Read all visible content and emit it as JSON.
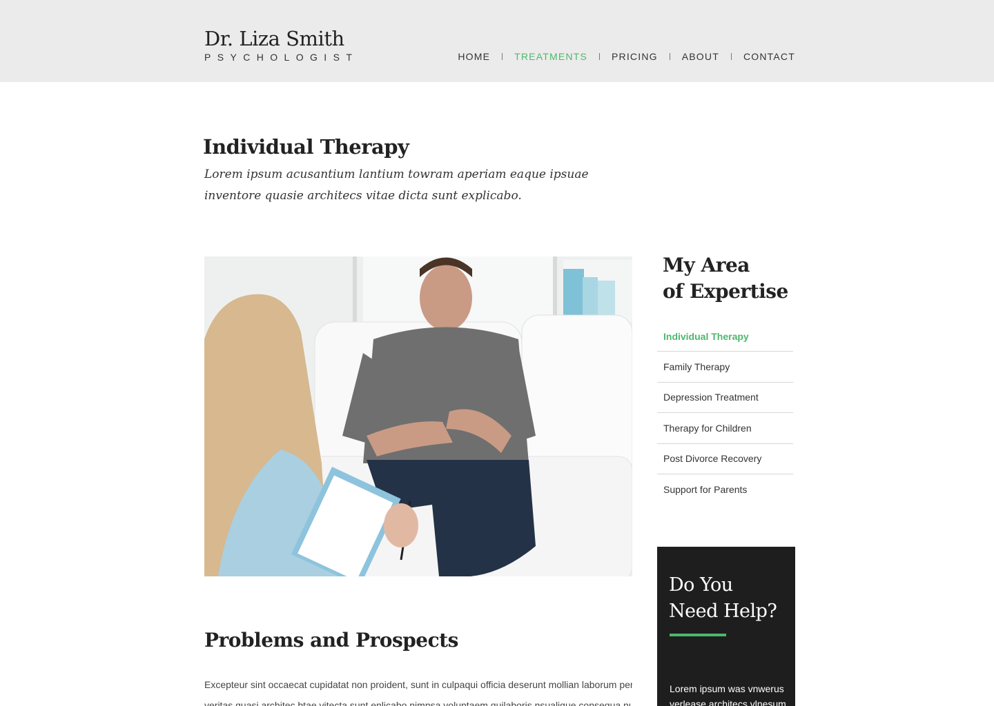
{
  "header": {
    "logo_name": "Dr. Liza Smith",
    "logo_sub": "PSYCHOLOGIST",
    "nav": [
      {
        "label": "HOME",
        "active": false
      },
      {
        "label": "TREATMENTS",
        "active": true
      },
      {
        "label": "PRICING",
        "active": false
      },
      {
        "label": "ABOUT",
        "active": false
      },
      {
        "label": "CONTACT",
        "active": false
      }
    ]
  },
  "main": {
    "title": "Individual Therapy",
    "intro": "Lorem ipsum acusantium lantium towram aperiam eaque ipsuae inventore quasie architecs vitae dicta sunt explicabo.",
    "section_title": "Problems and Prospects",
    "section_lines": [
      "Excepteur sint occaecat cupidatat non proident, sunt in culpaqui officia deserunt mollian laborum perscas",
      "veritas quasi architec btae vitecta sunt enlicabo nimpsa voluptaem quilaboris nsualique consequa nuisaute"
    ]
  },
  "sidebar": {
    "expertise_title_line1": "My Area",
    "expertise_title_line2": "of Expertise",
    "items": [
      {
        "label": "Individual Therapy",
        "active": true
      },
      {
        "label": "Family Therapy",
        "active": false
      },
      {
        "label": "Depression Treatment",
        "active": false
      },
      {
        "label": "Therapy for Children",
        "active": false
      },
      {
        "label": "Post Divorce Recovery",
        "active": false
      },
      {
        "label": "Support for Parents",
        "active": false
      }
    ],
    "help": {
      "title_line1": "Do You",
      "title_line2": "Need Help?",
      "text": "Lorem ipsum was vnwerus verlease architecs vlnesum"
    }
  },
  "colors": {
    "accent": "#4cb86b",
    "header_bg": "#ebebeb",
    "dark_box": "#1e1e1e"
  }
}
